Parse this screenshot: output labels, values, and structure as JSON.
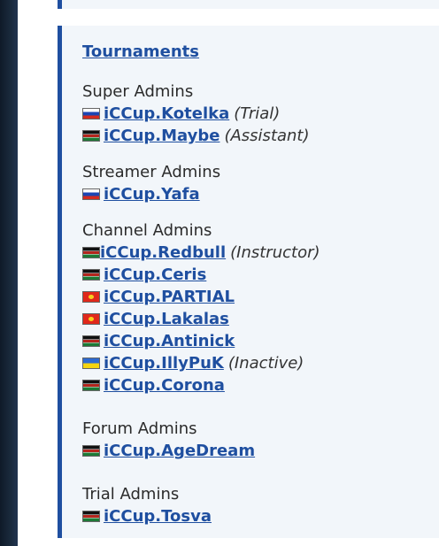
{
  "header_link": "Tournaments",
  "sections": [
    {
      "title": "Super Admins",
      "members": [
        {
          "flag": "flag-ru",
          "name": "iCCup.Kotelka",
          "role": "(Trial)"
        },
        {
          "flag": "flag-ke",
          "name": "iCCup.Maybe",
          "role": "(Assistant)"
        }
      ]
    },
    {
      "title": "Streamer Admins",
      "members": [
        {
          "flag": "flag-ru",
          "name": "iCCup.Yafa"
        }
      ]
    },
    {
      "title": "Channel Admins",
      "members": [
        {
          "flag": "flag-ke",
          "name": "iCCup.Redbull",
          "role": "(Instructor)"
        },
        {
          "flag": "flag-ke",
          "name": "iCCup.Ceris"
        },
        {
          "flag": "flag-kg",
          "name": "iCCup.PARTIAL"
        },
        {
          "flag": "flag-kg",
          "name": "iCCup.Lakalas"
        },
        {
          "flag": "flag-ke",
          "name": "iCCup.Antinick"
        },
        {
          "flag": "flag-ua",
          "name": "iCCup.IllyPuK",
          "role": "(Inactive)"
        },
        {
          "flag": "flag-ke",
          "name": "iCCup.Corona"
        }
      ]
    },
    {
      "title": "Forum Admins",
      "members": [
        {
          "flag": "flag-ke",
          "name": "iCCup.AgeDream"
        }
      ]
    },
    {
      "title": "Trial Admins",
      "members": [
        {
          "flag": "flag-ke",
          "name": "iCCup.Tosva"
        }
      ]
    }
  ],
  "colors": {
    "link": "#1f4fa0",
    "panel": "#f2f6fa",
    "accent_border": "#1f4fa0"
  }
}
